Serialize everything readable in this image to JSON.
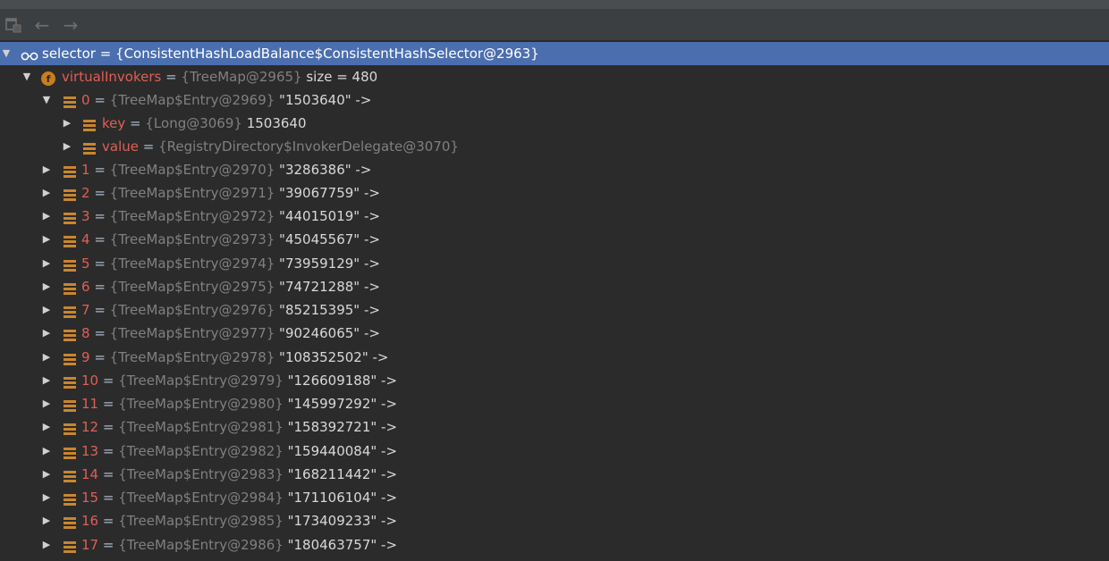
{
  "toolbar": {
    "icons": [
      "restore-layout-icon",
      "back-arrow-icon",
      "forward-arrow-icon"
    ],
    "back_glyph": "←",
    "forward_glyph": "→"
  },
  "colors": {
    "background": "#2b2b2b",
    "selection": "#4b6eaf",
    "field_name": "#e05f55",
    "reference": "#808080",
    "entry_icon": "#c9862e",
    "field_icon": "#c77f1e"
  },
  "tree": {
    "selector": {
      "name": "selector",
      "eq": " = ",
      "ref": "{ConsistentHashLoadBalance$ConsistentHashSelector@2963}",
      "icon": "watch-glasses-icon"
    },
    "virtual_invokers": {
      "name": "virtualInvokers",
      "eq": " = ",
      "ref": "{TreeMap@2965}",
      "value": "  size = 480",
      "icon": "field-f-icon",
      "icon_letter": "f"
    },
    "entry0": {
      "name": "0",
      "eq": " = ",
      "ref": "{TreeMap$Entry@2969}",
      "value": " \"1503640\" ->"
    },
    "key": {
      "name": "key",
      "eq": " = ",
      "ref": "{Long@3069}",
      "value": " 1503640"
    },
    "value": {
      "name": "value",
      "eq": " = ",
      "ref": "{RegistryDirectory$InvokerDelegate@3070}",
      "value": ""
    },
    "entries": [
      {
        "name": "1",
        "eq": " = ",
        "ref": "{TreeMap$Entry@2970}",
        "value": " \"3286386\" ->"
      },
      {
        "name": "2",
        "eq": " = ",
        "ref": "{TreeMap$Entry@2971}",
        "value": " \"39067759\" ->"
      },
      {
        "name": "3",
        "eq": " = ",
        "ref": "{TreeMap$Entry@2972}",
        "value": " \"44015019\" ->"
      },
      {
        "name": "4",
        "eq": " = ",
        "ref": "{TreeMap$Entry@2973}",
        "value": " \"45045567\" ->"
      },
      {
        "name": "5",
        "eq": " = ",
        "ref": "{TreeMap$Entry@2974}",
        "value": " \"73959129\" ->"
      },
      {
        "name": "6",
        "eq": " = ",
        "ref": "{TreeMap$Entry@2975}",
        "value": " \"74721288\" ->"
      },
      {
        "name": "7",
        "eq": " = ",
        "ref": "{TreeMap$Entry@2976}",
        "value": " \"85215395\" ->"
      },
      {
        "name": "8",
        "eq": " = ",
        "ref": "{TreeMap$Entry@2977}",
        "value": " \"90246065\" ->"
      },
      {
        "name": "9",
        "eq": " = ",
        "ref": "{TreeMap$Entry@2978}",
        "value": " \"108352502\" ->"
      },
      {
        "name": "10",
        "eq": " = ",
        "ref": "{TreeMap$Entry@2979}",
        "value": " \"126609188\" ->"
      },
      {
        "name": "11",
        "eq": " = ",
        "ref": "{TreeMap$Entry@2980}",
        "value": " \"145997292\" ->"
      },
      {
        "name": "12",
        "eq": " = ",
        "ref": "{TreeMap$Entry@2981}",
        "value": " \"158392721\" ->"
      },
      {
        "name": "13",
        "eq": " = ",
        "ref": "{TreeMap$Entry@2982}",
        "value": " \"159440084\" ->"
      },
      {
        "name": "14",
        "eq": " = ",
        "ref": "{TreeMap$Entry@2983}",
        "value": " \"168211442\" ->"
      },
      {
        "name": "15",
        "eq": " = ",
        "ref": "{TreeMap$Entry@2984}",
        "value": " \"171106104\" ->"
      },
      {
        "name": "16",
        "eq": " = ",
        "ref": "{TreeMap$Entry@2985}",
        "value": " \"173409233\" ->"
      },
      {
        "name": "17",
        "eq": " = ",
        "ref": "{TreeMap$Entry@2986}",
        "value": " \"180463757\" ->"
      }
    ]
  }
}
